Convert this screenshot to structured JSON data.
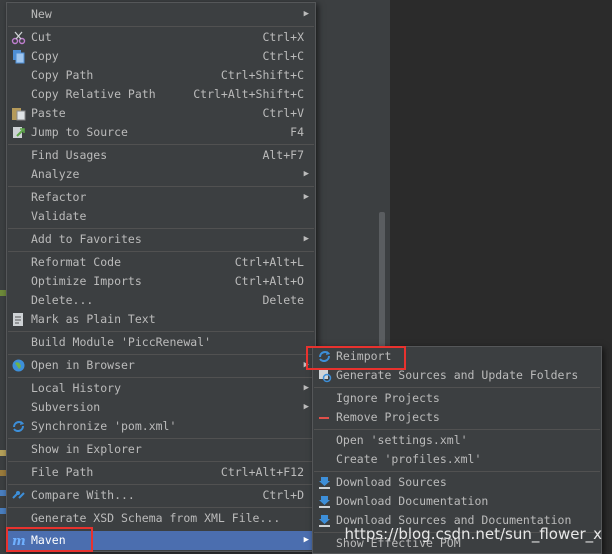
{
  "main_menu": {
    "new": "New",
    "cut": "Cut",
    "cut_sc": "Ctrl+X",
    "copy": "Copy",
    "copy_sc": "Ctrl+C",
    "copy_path": "Copy Path",
    "copy_path_sc": "Ctrl+Shift+C",
    "copy_rel_path": "Copy Relative Path",
    "copy_rel_path_sc": "Ctrl+Alt+Shift+C",
    "paste": "Paste",
    "paste_sc": "Ctrl+V",
    "jump_to_source": "Jump to Source",
    "jump_to_source_sc": "F4",
    "find_usages": "Find Usages",
    "find_usages_sc": "Alt+F7",
    "analyze": "Analyze",
    "refactor": "Refactor",
    "validate": "Validate",
    "add_to_favorites": "Add to Favorites",
    "reformat_code": "Reformat Code",
    "reformat_code_sc": "Ctrl+Alt+L",
    "optimize_imports": "Optimize Imports",
    "optimize_imports_sc": "Ctrl+Alt+O",
    "delete": "Delete...",
    "delete_sc": "Delete",
    "mark_plain_text": "Mark as Plain Text",
    "build_module": "Build Module 'PiccRenewal'",
    "open_in_browser": "Open in Browser",
    "local_history": "Local History",
    "subversion": "Subversion",
    "synchronize": "Synchronize 'pom.xml'",
    "show_in_explorer": "Show in Explorer",
    "file_path": "File Path",
    "file_path_sc": "Ctrl+Alt+F12",
    "compare_with": "Compare With...",
    "compare_with_sc": "Ctrl+D",
    "generate_xsd": "Generate XSD Schema from XML File...",
    "maven": "Maven"
  },
  "maven_submenu": {
    "reimport": "Reimport",
    "generate_sources": "Generate Sources and Update Folders",
    "ignore_projects": "Ignore Projects",
    "remove_projects": "Remove Projects",
    "open_settings": "Open 'settings.xml'",
    "create_profiles": "Create 'profiles.xml'",
    "download_sources": "Download Sources",
    "download_docs": "Download Documentation",
    "download_sources_docs": "Download Sources and Documentation",
    "show_effective_pom": "Show Effective POM"
  },
  "watermark": "https://blog.csdn.net/sun_flower_x",
  "colors": {
    "menu_bg": "#3c3f41",
    "selection": "#4b6eaf",
    "highlight_box": "#e8322e",
    "text": "#bbbbbb"
  }
}
